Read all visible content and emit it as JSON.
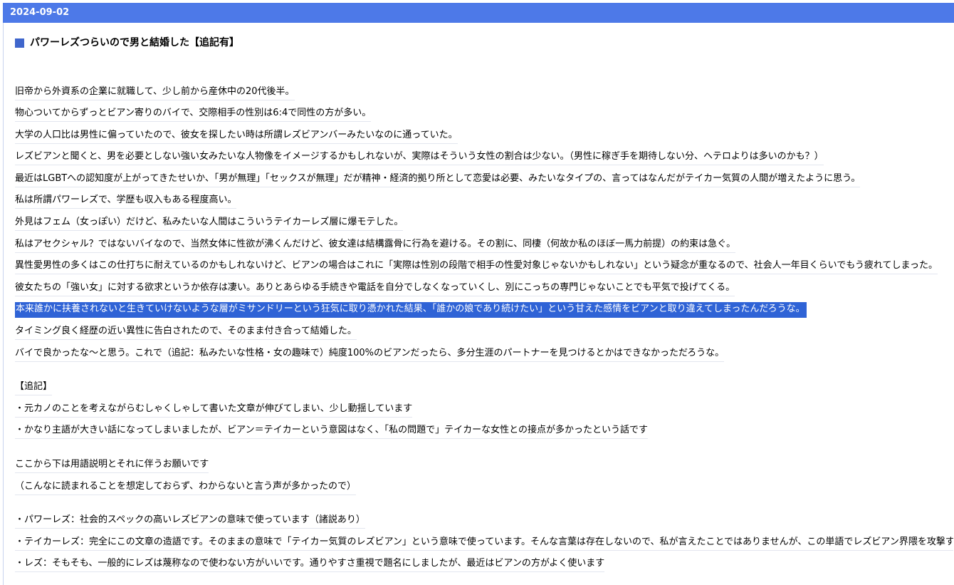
{
  "header": {
    "date": "2024-09-02"
  },
  "article": {
    "title": "パワーレズつらいので男と結婚した【追記有】",
    "paragraphs": [
      "旧帝から外資系の企業に就職して、少し前から産休中の20代後半。",
      "物心ついてからずっとビアン寄りのバイで、交際相手の性別は6:4で同性の方が多い。",
      "大学の人口比は男性に偏っていたので、彼女を探したい時は所謂レズビアンバーみたいなのに通っていた。",
      "レズビアンと聞くと、男を必要としない強い女みたいな人物像をイメージするかもしれないが、実際はそういう女性の割合は少ない。（男性に稼ぎ手を期待しない分、ヘテロよりは多いのかも？）",
      "最近はLGBTへの認知度が上がってきたせいか、「男が無理」「セックスが無理」だが精神・経済的拠り所として恋愛は必要、みたいなタイプの、言ってはなんだがテイカー気質の人間が増えたように思う。",
      "私は所謂パワーレズで、学歴も収入もある程度高い。",
      "外見はフェム（女っぽい）だけど、私みたいな人間はこういうテイカーレズ層に爆モテした。",
      "私はアセクシャル？ではないバイなので、当然女体に性欲が沸くんだけど、彼女達は結構露骨に行為を避ける。その割に、同棲（何故か私のほぼ一馬力前提）の約束は急ぐ。",
      "異性愛男性の多くはこの仕打ちに耐えているのかもしれないけど、ビアンの場合はこれに「実際は性別の段階で相手の性愛対象じゃないかもしれない」という疑念が重なるので、社会人一年目くらいでもう疲れてしまった。",
      "彼女たちの「強い女」に対する欲求というか依存は凄い。ありとあらゆる手続きや電話を自分でしなくなっていくし、別にこっちの専門じゃないことでも平気で投げてくる。",
      "本来誰かに扶養されないと生きていけないような層がミサンドリーという狂気に取り憑かれた結果、「誰かの娘であり続けたい」という甘えた感情をビアンと取り違えてしまったんだろうな。",
      "タイミング良く経歴の近い異性に告白されたので、そのまま付き合って結婚した。",
      "バイで良かったな～と思う。これで（追記：私みたいな性格・女の趣味で）純度100%のビアンだったら、多分生涯のパートナーを見つけるとかはできなかっただろうな。"
    ],
    "addendum": [
      "【追記】",
      "・元カノのことを考えながらむしゃくしゃして書いた文章が伸びてしまい、少し動揺しています",
      "・かなり主語が大きい話になってしまいましたが、ビアン＝テイカーという意図はなく、「私の問題で」テイカーな女性との接点が多かったという話です"
    ],
    "glossary_intro": [
      "ここから下は用語説明とそれに伴うお願いです",
      "（こんなに読まれることを想定しておらず、わからないと言う声が多かったので）"
    ],
    "glossary": [
      "・パワーレズ：社会的スペックの高いレズビアンの意味で使っています（諸説あり）",
      "・テイカーレズ：完全にこの文章の造語です。そのままの意味で「テイカー気質のレズビアン」という意味で使っています。そんな言葉は存在しないので、私が言えたことではありませんが、この単語でレズビアン界隈を攻撃するのはやめてください",
      "・レズ：そもそも、一般的にレズは蔑称なので使わない方がいいです。通りやすさ重視で題名にしましたが、最近はビアンの方がよく使います"
    ]
  },
  "colors": {
    "header_background": "#4d79e8",
    "title_marker": "#3f66cc",
    "selection_background": "#2f63d6"
  }
}
